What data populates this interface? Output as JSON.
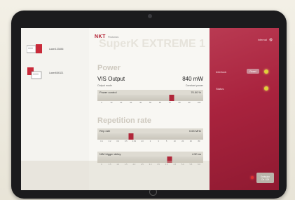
{
  "devices": [
    {
      "label": "Laser123456"
    },
    {
      "label": "Laser654321"
    }
  ],
  "brand": {
    "logo": "NKT",
    "sub": "Photonics"
  },
  "watermark": "SuperK EXTREME 1",
  "power": {
    "title": "Power",
    "output_label": "VIS Output",
    "output_value": "840 mW",
    "mode_label": "Output mode",
    "mode_value": "Constant power",
    "control_label": "Power control",
    "control_value": "70.00 %",
    "control_fraction": 0.7,
    "ticks": [
      "0",
      "10",
      "20",
      "30",
      "40",
      "50",
      "60",
      "70",
      "80",
      "90",
      "100"
    ]
  },
  "repetition": {
    "title": "Repetition rate",
    "rate_label": "Rep rate",
    "rate_value": "0.63 MHz",
    "rate_fraction": 0.32,
    "rate_ticks": [
      "0.1",
      "0.2",
      "0.3",
      "0.5",
      "0.63",
      "1.0",
      "2",
      "3",
      "5",
      "10",
      "20",
      "40",
      "80"
    ],
    "delay_label": "NIM trigger delay",
    "delay_value": "4.50 ns",
    "delay_fraction": 0.68,
    "delay_ticks": [
      "0",
      "0.5",
      "1.0",
      "1.5",
      "2.0",
      "2.5",
      "3.0",
      "3.5",
      "4.0",
      "4.5",
      "5.0",
      "5.5",
      "6.0"
    ]
  },
  "right": {
    "internal_label": "Internal",
    "interlock_label": "Interlock",
    "interlock_button": "Reset",
    "status_label": "Status",
    "emission_line1": "Emission",
    "emission_line2": "On / Off"
  },
  "colors": {
    "accent": "#b0273a",
    "panel": "#a9233e",
    "indicator": "#e0d03a"
  }
}
